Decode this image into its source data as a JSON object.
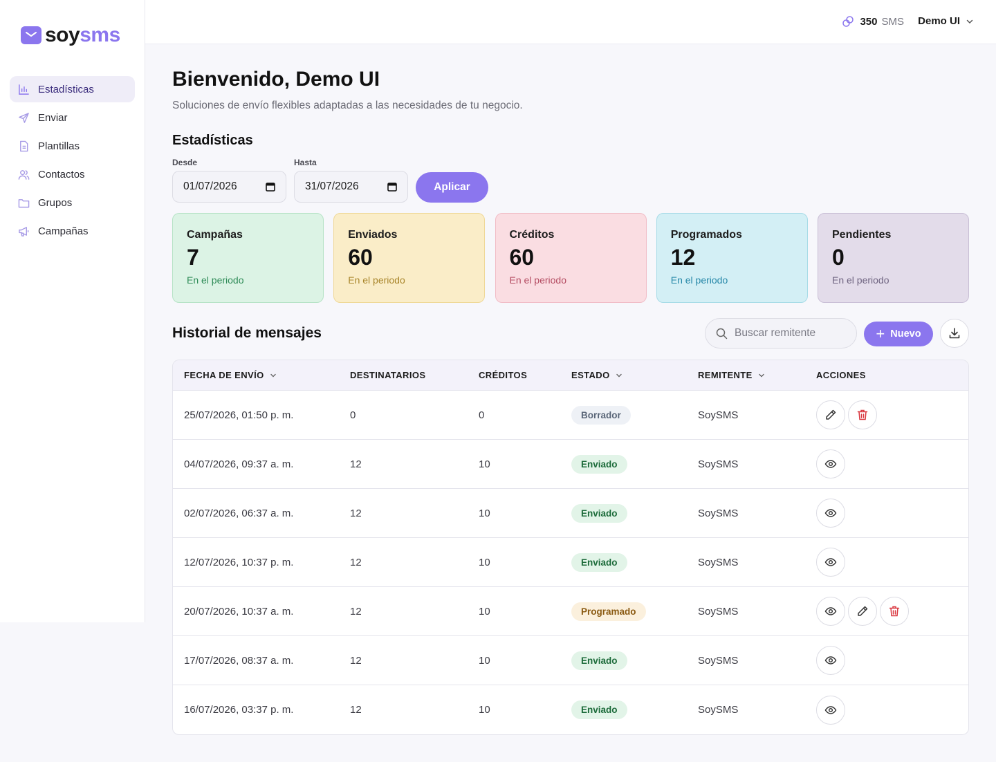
{
  "brand": {
    "part1": "soy",
    "part2": "sms",
    "accent": "#8b76ee"
  },
  "sidebar": {
    "items": [
      {
        "label": "Estadísticas",
        "icon": "bar-chart-icon",
        "active": true
      },
      {
        "label": "Enviar",
        "icon": "send-icon"
      },
      {
        "label": "Plantillas",
        "icon": "document-icon"
      },
      {
        "label": "Contactos",
        "icon": "users-icon"
      },
      {
        "label": "Grupos",
        "icon": "folder-icon"
      },
      {
        "label": "Campañas",
        "icon": "megaphone-icon"
      }
    ]
  },
  "header": {
    "credits_value": "350",
    "credits_unit": "SMS",
    "user_name": "Demo UI"
  },
  "main": {
    "title": "Bienvenido, Demo UI",
    "subtitle": "Soluciones de envío flexibles adaptadas a las necesidades de tu negocio.",
    "stats_title": "Estadísticas",
    "filters": {
      "from_label": "Desde",
      "from_value": "01/07/2026",
      "to_label": "Hasta",
      "to_value": "31/07/2026",
      "apply_label": "Aplicar"
    },
    "cards": [
      {
        "label": "Campañas",
        "value": "7",
        "sub": "En el periodo",
        "bg": "#dcf3e5",
        "border": "#b6e3c6",
        "sub_color": "#2e8b57"
      },
      {
        "label": "Enviados",
        "value": "60",
        "sub": "En el periodo",
        "bg": "#faedc8",
        "border": "#efd897",
        "sub_color": "#a8852a"
      },
      {
        "label": "Créditos",
        "value": "60",
        "sub": "En el periodo",
        "bg": "#fadde2",
        "border": "#f1bcc6",
        "sub_color": "#b44c62"
      },
      {
        "label": "Programados",
        "value": "12",
        "sub": "En el periodo",
        "bg": "#d3eff5",
        "border": "#a7dbe7",
        "sub_color": "#2587a8"
      },
      {
        "label": "Pendientes",
        "value": "0",
        "sub": "En el periodo",
        "bg": "#e3dcea",
        "border": "#c9bfd6",
        "sub_color": "#6e6380"
      }
    ],
    "history": {
      "title": "Historial de mensajes",
      "search_placeholder": "Buscar remitente",
      "new_label": "Nuevo",
      "columns": [
        "FECHA DE ENVÍO",
        "DESTINATARIOS",
        "CRÉDITOS",
        "ESTADO",
        "REMITENTE",
        "ACCIONES"
      ],
      "rows": [
        {
          "date": "25/07/2026, 01:50 p. m.",
          "recipients": "0",
          "credits": "0",
          "status": "Borrador",
          "sender": "SoySMS"
        },
        {
          "date": "04/07/2026, 09:37 a. m.",
          "recipients": "12",
          "credits": "10",
          "status": "Enviado",
          "sender": "SoySMS"
        },
        {
          "date": "02/07/2026, 06:37 a. m.",
          "recipients": "12",
          "credits": "10",
          "status": "Enviado",
          "sender": "SoySMS"
        },
        {
          "date": "12/07/2026, 10:37 p. m.",
          "recipients": "12",
          "credits": "10",
          "status": "Enviado",
          "sender": "SoySMS"
        },
        {
          "date": "20/07/2026, 10:37 a. m.",
          "recipients": "12",
          "credits": "10",
          "status": "Programado",
          "sender": "SoySMS"
        },
        {
          "date": "17/07/2026, 08:37 a. m.",
          "recipients": "12",
          "credits": "10",
          "status": "Enviado",
          "sender": "SoySMS"
        },
        {
          "date": "16/07/2026, 03:37 p. m.",
          "recipients": "12",
          "credits": "10",
          "status": "Enviado",
          "sender": "SoySMS"
        }
      ]
    }
  }
}
